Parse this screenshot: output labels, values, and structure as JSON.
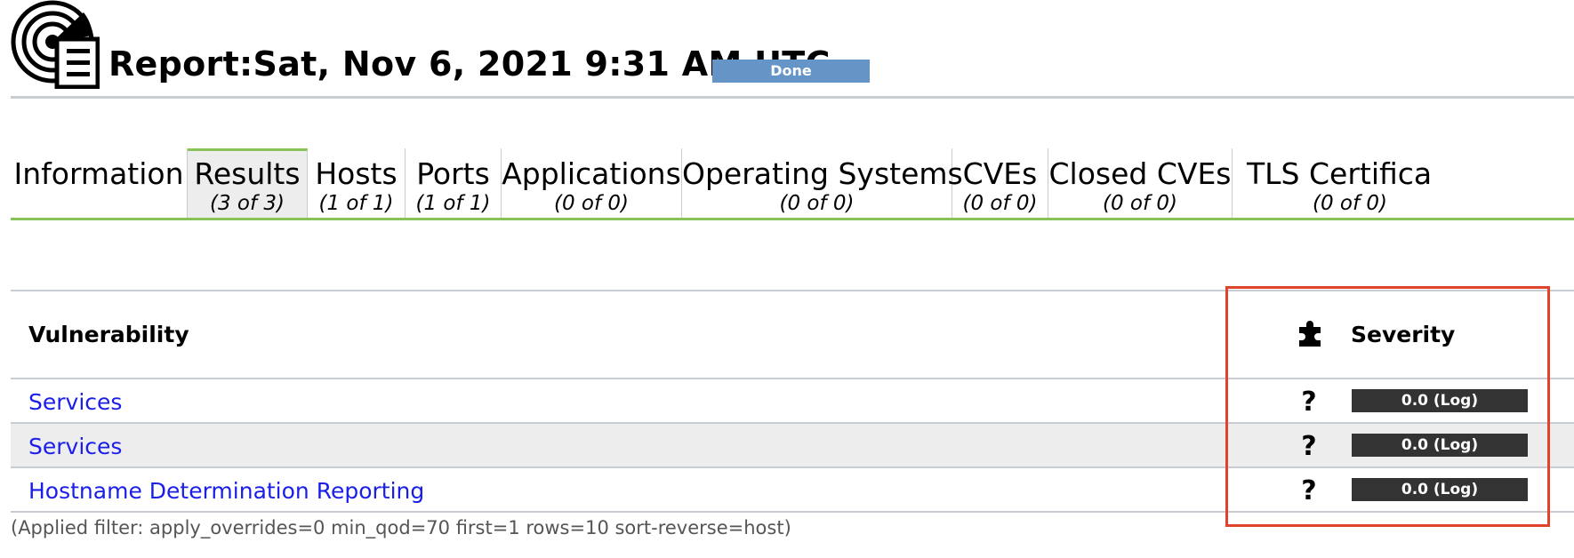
{
  "header": {
    "title": "Report:Sat, Nov 6, 2021 9:31 AM UTC",
    "status": "Done"
  },
  "tabs": [
    {
      "label": "Information",
      "count": ""
    },
    {
      "label": "Results",
      "count": "(3 of 3)"
    },
    {
      "label": "Hosts",
      "count": "(1 of 1)"
    },
    {
      "label": "Ports",
      "count": "(1 of 1)"
    },
    {
      "label": "Applications",
      "count": "(0 of 0)"
    },
    {
      "label": "Operating Systems",
      "count": "(0 of 0)"
    },
    {
      "label": "CVEs",
      "count": "(0 of 0)"
    },
    {
      "label": "Closed CVEs",
      "count": "(0 of 0)"
    },
    {
      "label": "TLS Certifica",
      "count": "(0 of 0)"
    }
  ],
  "table": {
    "columns": {
      "vulnerability": "Vulnerability",
      "severity": "Severity"
    },
    "rows": [
      {
        "vulnerability": "Services",
        "qod": "?",
        "severity": "0.0 (Log)"
      },
      {
        "vulnerability": "Services",
        "qod": "?",
        "severity": "0.0 (Log)"
      },
      {
        "vulnerability": "Hostname Determination Reporting",
        "qod": "?",
        "severity": "0.0 (Log)"
      }
    ]
  },
  "filter_note": "(Applied filter: apply_overrides=0 min_qod=70 first=1 rows=10 sort-reverse=host)",
  "icons": {
    "report": "report-radar-icon",
    "solution_type": "puzzle-piece-icon"
  },
  "colors": {
    "status_bar": "#6495c6",
    "tab_accent": "#88c358",
    "link": "#1a1ee8",
    "severity_bar": "#333333",
    "highlight": "#e0422b"
  }
}
